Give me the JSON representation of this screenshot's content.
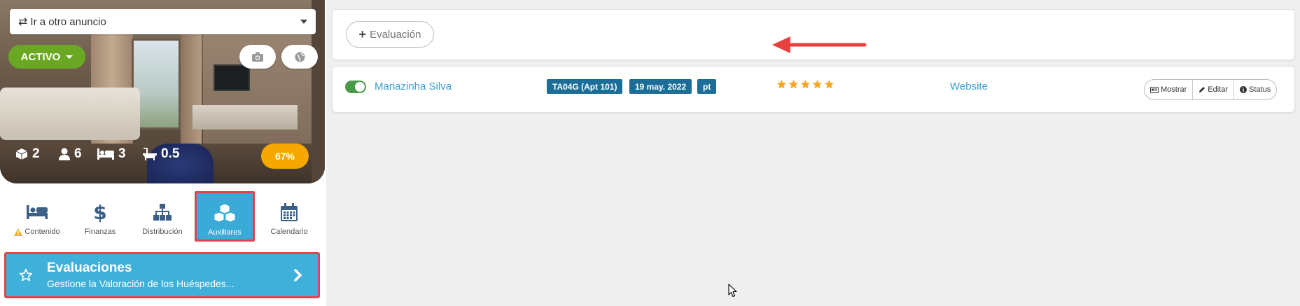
{
  "sidebar": {
    "goto_select": {
      "label": "Ir a otro anuncio",
      "icon": "swap-arrows-icon"
    },
    "status": {
      "label": "ACTIVO",
      "color": "#6aa823"
    },
    "stats": {
      "units": "2",
      "guests": "6",
      "beds": "3",
      "baths": "0.5"
    },
    "completion": {
      "label": "67%",
      "value": 0.67,
      "color": "#f6a800"
    },
    "tabs": [
      {
        "label": "Contenido",
        "icon": "bed-icon",
        "warning": true
      },
      {
        "label": "Finanzas",
        "icon": "dollar-icon"
      },
      {
        "label": "Distribución",
        "icon": "sitemap-icon"
      },
      {
        "label": "Auxiliares",
        "icon": "cubes-icon",
        "active": true
      },
      {
        "label": "Calendario",
        "icon": "calendar-icon"
      }
    ],
    "section": {
      "title": "Evaluaciones",
      "subtitle": "Gestione la Valoración de los Huéspedes..."
    }
  },
  "main": {
    "add_button": {
      "label": "Evaluación"
    },
    "review": {
      "guest": "Mariazinha Silva",
      "enabled": true,
      "tags": {
        "code": "TA04G (Apt 101)",
        "date": "19 may. 2022",
        "lang": "pt"
      },
      "rating": 5,
      "rating_max": 5,
      "source": "Website",
      "actions": {
        "show": "Mostrar",
        "edit": "Editar",
        "status": "Status"
      }
    }
  },
  "colors": {
    "accent": "#3fb0d9",
    "highlight_border": "#e04450",
    "tag": "#1c6e99",
    "link": "#3a9fd0",
    "star": "#f5a623"
  }
}
